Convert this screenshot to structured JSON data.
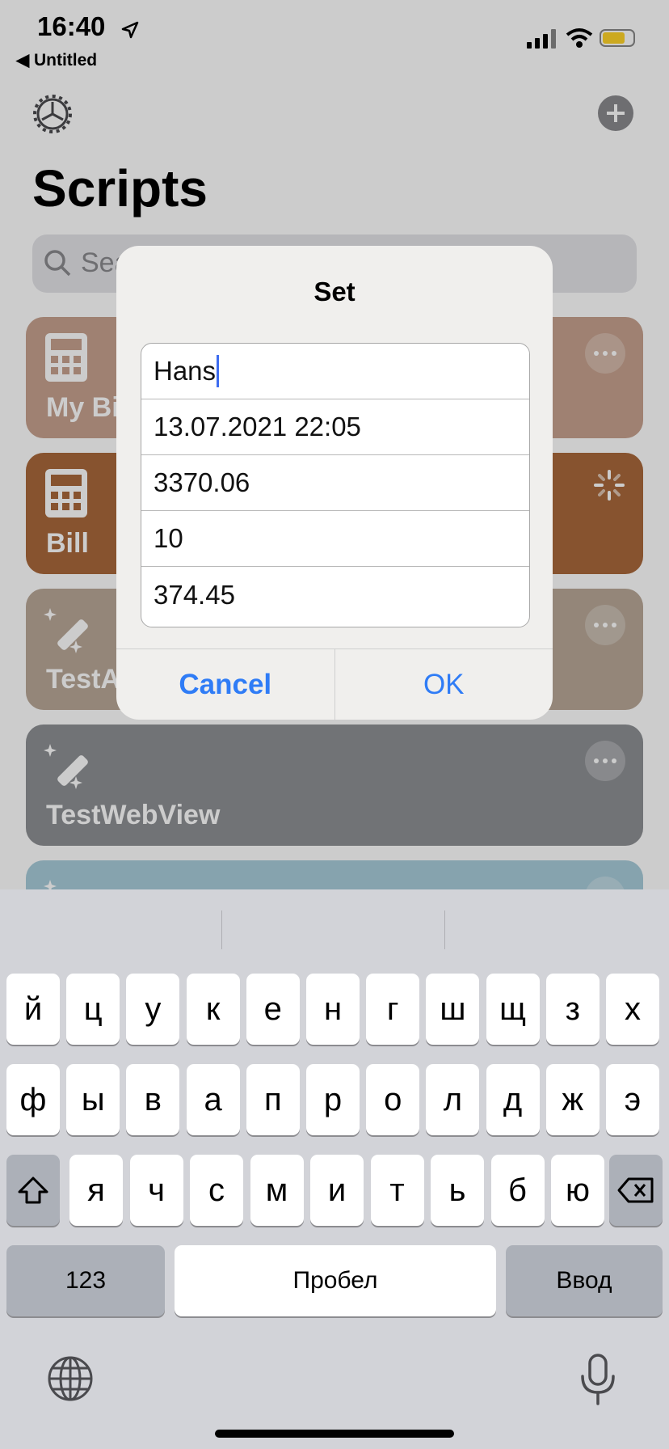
{
  "status_bar": {
    "time": "16:40",
    "back_label": "◀ Untitled"
  },
  "app": {
    "title": "Scripts",
    "search_placeholder": "Search",
    "cards": [
      {
        "label": "My Bill",
        "color": "#c7a28f",
        "icon": "calculator-icon",
        "action": "more"
      },
      {
        "label": "Bill",
        "color": "#a9683b",
        "icon": "calculator-icon",
        "action": "loading"
      },
      {
        "label": "TestAlert",
        "color": "#b9a898",
        "icon": "magic-wand-icon",
        "action": "more"
      },
      {
        "label": "TestWebView",
        "color": "#8e9094",
        "icon": "magic-wand-icon",
        "action": "more"
      },
      {
        "label": "",
        "color": "#a8ccda",
        "icon": "magic-wand-icon",
        "action": "more"
      }
    ]
  },
  "dialog": {
    "title": "Set",
    "fields": [
      "Hans",
      "13.07.2021 22:05",
      "3370.06",
      "10",
      "374.45"
    ],
    "cancel_label": "Cancel",
    "ok_label": "OK",
    "accent_color": "#2f7cf6"
  },
  "keyboard": {
    "row1": [
      "й",
      "ц",
      "у",
      "к",
      "е",
      "н",
      "г",
      "ш",
      "щ",
      "з",
      "х"
    ],
    "row2": [
      "ф",
      "ы",
      "в",
      "а",
      "п",
      "р",
      "о",
      "л",
      "д",
      "ж",
      "э"
    ],
    "row3": [
      "я",
      "ч",
      "с",
      "м",
      "и",
      "т",
      "ь",
      "б",
      "ю"
    ],
    "numbers_label": "123",
    "space_label": "Пробел",
    "return_label": "Ввод"
  }
}
